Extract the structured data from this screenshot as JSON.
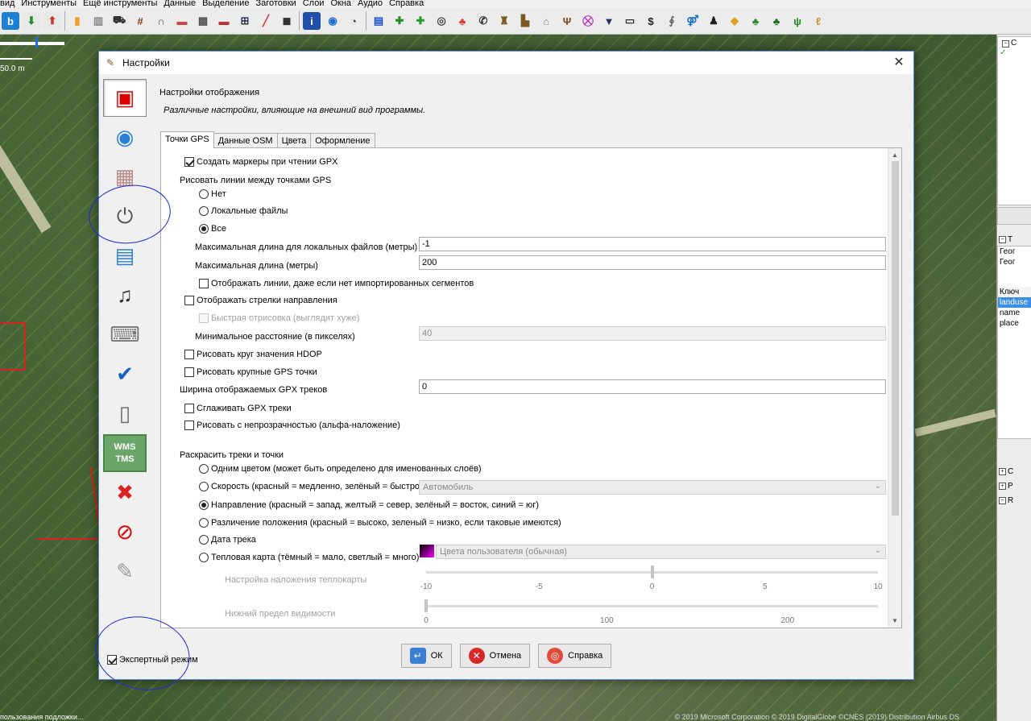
{
  "menu": [
    "вид",
    "Инструменты",
    "Ещё инструменты",
    "Данные",
    "Выделение",
    "Заготовки",
    "Слои",
    "Окна",
    "Аудио",
    "Справка"
  ],
  "toolbar_icons": [
    "bing-icon",
    "download-icon",
    "upload-icon",
    "building-icon",
    "building-alt-icon",
    "tractor-icon",
    "railway-icon",
    "gate-icon",
    "wall-icon",
    "grid-icon",
    "brick-icon",
    "fence-icon",
    "barrier-icon",
    "car-icon",
    "info-icon",
    "globe-icon",
    "clock-icon",
    "russia-flag-icon",
    "pharmacy-icon",
    "cross-icon",
    "eye-icon",
    "balloons-icon",
    "phone-icon",
    "castle-icon",
    "factory-icon",
    "house-icon",
    "cutlery-icon",
    "cart-icon",
    "shirt-icon",
    "tv-icon",
    "dollar-icon",
    "paperclip-icon",
    "toilets-icon",
    "person-icon",
    "bag-icon",
    "tree-icon",
    "forest-icon",
    "grass-icon",
    "wheat-icon"
  ],
  "map": {
    "scale_label": "50.0 m",
    "status_text": "пользования подложки...",
    "copyright": "© 2019 Microsoft Corporation © 2019 DigitalGlobe ©CNES (2019) Distribution Airbus DS"
  },
  "right_panel": {
    "box1_title": "С",
    "box2_title": "Т",
    "box2_items": [
      "Геог",
      "Геог"
    ],
    "key_header": "Ключ",
    "tags": [
      "landuse",
      "name",
      "place"
    ],
    "bottom_rows": [
      "С",
      "Р",
      "R"
    ]
  },
  "dialog": {
    "title": "Настройки",
    "close": "✕",
    "heading": "Настройки отображения",
    "description": "Различные настройки, влияющие на внешний вид программы.",
    "categories": [
      "display-settings",
      "map-projection",
      "imagery-grid",
      "plugins",
      "toolbar-layout",
      "audio",
      "keyboard-shortcuts",
      "validator",
      "remote-control",
      "wms-tms",
      "advanced",
      "tag-restrictions",
      "map-paint-styles"
    ],
    "wms_label_1": "WMS",
    "wms_label_2": "TMS",
    "expert_mode": {
      "label": "Экспертный режим",
      "checked": true
    },
    "tabs": [
      "Точки GPS",
      "Данные OSM",
      "Цвета",
      "Оформление"
    ],
    "active_tab": "Точки GPS",
    "gps": {
      "create_markers": "Создать маркеры при чтении GPX",
      "draw_lines_header": "Рисовать линии между точками GPS",
      "draw_lines_options": [
        "Нет",
        "Локальные файлы",
        "Все"
      ],
      "draw_lines_selected": "Все",
      "max_len_local_label": "Максимальная длина для локальных файлов (метры)",
      "max_len_local_value": "-1",
      "max_len_label": "Максимальная длина (метры)",
      "max_len_value": "200",
      "show_lines_no_segments": "Отображать линии, даже если нет импортированных сегментов",
      "show_arrows": "Отображать стрелки направления",
      "fast_draw": "Быстрая отрисовка (выглядит хуже)",
      "min_distance_label": "Минимальное расстояние (в пикселях)",
      "min_distance_value": "40",
      "hdop_circle": "Рисовать круг значения HDOP",
      "large_points": "Рисовать крупные GPS точки",
      "track_width_label": "Ширина отображаемых GPX треков",
      "track_width_value": "0",
      "smooth_tracks": "Сглаживать GPX треки",
      "alpha_blend": "Рисовать с непрозрачностью (альфа-наложение)",
      "color_header": "Раскрасить треки и точки",
      "color_options": [
        "Одним цветом (может быть определено для именованных слоёв)",
        "Скорость (красный = медленно, зелёный = быстро)",
        "Направление (красный = запад, желтый = север, зелёный = восток, синий = юг)",
        "Различение положения (красный = высоко, зеленый = низко, если таковые имеются)",
        "Дата трека",
        "Тепловая карта (тёмный = мало, светлый = много)"
      ],
      "color_selected": "Направление (красный = запад, желтый = север, зелёный = восток, синий = юг)",
      "speed_combo": "Автомобиль",
      "heatmap_combo": "Цвета пользователя (обычная)",
      "heatmap_overlay_label": "Настройка наложения теплокарты",
      "heatmap_overlay": {
        "min": -10,
        "max": 10,
        "value": 0,
        "ticks": [
          "-10",
          "-5",
          "0",
          "5",
          "10"
        ]
      },
      "visibility_label": "Нижний предел видимости",
      "visibility": {
        "min": 0,
        "max": 250,
        "value": 0,
        "ticks": [
          "0",
          "100",
          "200"
        ]
      }
    },
    "buttons": {
      "ok": "ОК",
      "cancel": "Отмена",
      "help": "Справка"
    }
  },
  "colors": {
    "selection": "#3a8ee6",
    "annotation": "#1b2ad6",
    "dialog_border": "#5b8fd4"
  }
}
